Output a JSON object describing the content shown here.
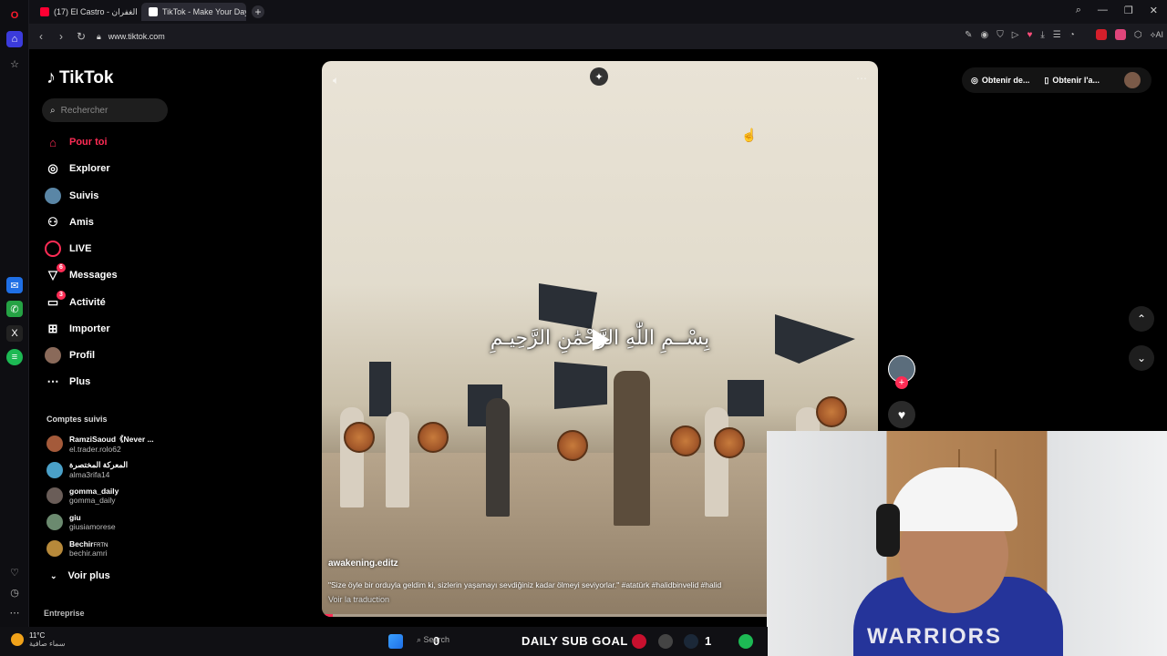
{
  "browser": {
    "tabs": [
      {
        "label": "(17) El Castro - الله الغفران",
        "active": false,
        "favicon_color": "#ff0033"
      },
      {
        "label": "TikTok - Make Your Day",
        "active": true,
        "favicon_color": "#ffffff"
      }
    ],
    "url": "www.tiktok.com"
  },
  "sidebar": {
    "logo": "TikTok",
    "search_placeholder": "Rechercher",
    "nav": [
      {
        "label": "Pour toi",
        "icon": "home-icon",
        "active": true
      },
      {
        "label": "Explorer",
        "icon": "compass-icon"
      },
      {
        "label": "Suivis",
        "icon": "following-icon"
      },
      {
        "label": "Amis",
        "icon": "friends-icon"
      },
      {
        "label": "LIVE",
        "icon": "live-icon"
      },
      {
        "label": "Messages",
        "icon": "messages-icon",
        "badge": "6"
      },
      {
        "label": "Activité",
        "icon": "activity-icon",
        "badge": "3"
      },
      {
        "label": "Importer",
        "icon": "upload-icon"
      },
      {
        "label": "Profil",
        "icon": "profile-icon"
      },
      {
        "label": "Plus",
        "icon": "more-icon"
      }
    ],
    "following_title": "Comptes suivis",
    "following": [
      {
        "name": "RamziSaoud《Never ...",
        "handle": "el.trader.rolo62",
        "color": "#a45a3a"
      },
      {
        "name": "المعركة المختصرة",
        "handle": "alma3rifa14",
        "color": "#4aa0c8"
      },
      {
        "name": "gomma_daily",
        "handle": "gomma_daily",
        "color": "#6a5d58"
      },
      {
        "name": "giu",
        "handle": "giusiamorese",
        "color": "#6b8a6f"
      },
      {
        "name": "Bechir",
        "name_suffix": "FRTN",
        "handle": "bechir.amri",
        "color": "#b7893a"
      }
    ],
    "see_more": "Voir plus",
    "footer": "Entreprise"
  },
  "video": {
    "overlay_title": "بِسْــمِ اللّٰهِ الرَّحْمَٰنِ الرَّحِيـمِ",
    "author": "awakening.editz",
    "caption": "\"Size öyle bir orduyla geldim ki, sizlerin yaşamayı sevdiğiniz kadar ölmeyi seviyorlar.\" #atatürk #halidbinvelid #halid",
    "translate": "Voir la traduction",
    "progress": 0.02
  },
  "topbar": {
    "get_coins": "Obtenir de...",
    "get_app": "Obtenir l'a..."
  },
  "taskbar": {
    "temperature": "11°C",
    "weather_desc": "سماء صافية",
    "search_label": "Search",
    "sub_goal": "DAILY SUB GOAL",
    "sub_left": "0",
    "sub_right": "1"
  },
  "webcam": {
    "hoodie_text": "WARRIORS"
  }
}
